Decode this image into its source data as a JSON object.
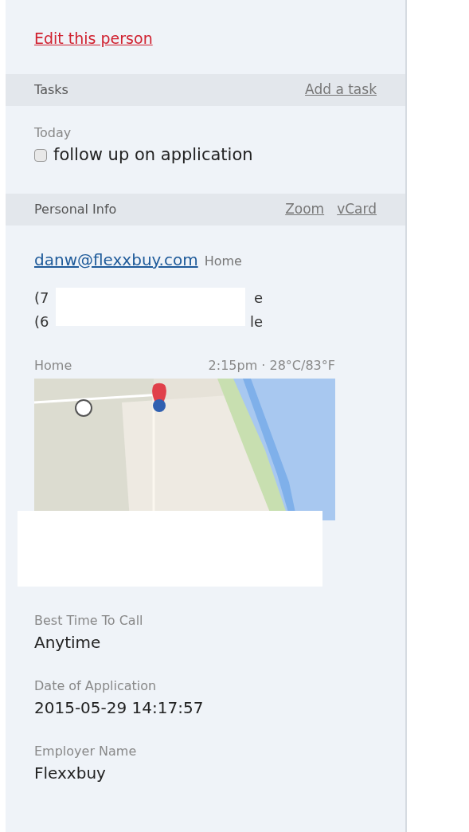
{
  "edit_link": "Edit this person",
  "tasks": {
    "title": "Tasks",
    "action": "Add a task",
    "groups": [
      {
        "label": "Today",
        "items": [
          {
            "text": "follow up on application",
            "checked": false
          }
        ]
      }
    ]
  },
  "personal_info": {
    "title": "Personal Info",
    "actions": [
      "Zoom",
      "vCard"
    ],
    "email": {
      "address": "danw@flexxbuy.com",
      "type": "Home"
    },
    "phones": [
      {
        "visible_start": "(7",
        "visible_end": "e"
      },
      {
        "visible_start": "(6",
        "visible_end": "le"
      }
    ],
    "address": {
      "label": "Home",
      "local_info": "2:15pm · 28°C/83°F"
    },
    "fields": [
      {
        "label": "Best Time To Call",
        "value": "Anytime"
      },
      {
        "label": "Date of Application",
        "value": "2015-05-29 14:17:57"
      },
      {
        "label": "Employer Name",
        "value": "Flexxbuy"
      }
    ]
  }
}
